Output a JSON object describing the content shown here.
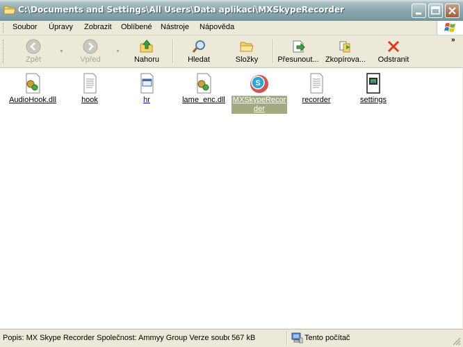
{
  "window": {
    "title": "C:\\Documents and Settings\\All Users\\Data aplikací\\MXSkypeRecorder"
  },
  "menu": [
    {
      "label": "Soubor"
    },
    {
      "label": "Úpravy"
    },
    {
      "label": "Zobrazit"
    },
    {
      "label": "Oblíbené"
    },
    {
      "label": "Nástroje"
    },
    {
      "label": "Nápověda"
    }
  ],
  "toolbar": {
    "back": "Zpět",
    "forward": "Vpřed",
    "up": "Nahoru",
    "search": "Hledat",
    "folders": "Složky",
    "move": "Přesunout...",
    "copy": "Zkopírova...",
    "delete": "Odstranit"
  },
  "files": [
    {
      "name": "AudioHook.dll",
      "icon": "dll-icon"
    },
    {
      "name": "hook",
      "icon": "text-file-icon"
    },
    {
      "name": "hr",
      "icon": "html-file-icon"
    },
    {
      "name": "lame_enc.dll",
      "icon": "dll-icon"
    },
    {
      "name": "MXSkypeRecorder",
      "icon": "skype-recorder-icon",
      "selected": true
    },
    {
      "name": "recorder",
      "icon": "text-file-icon"
    },
    {
      "name": "settings",
      "icon": "image-file-icon"
    }
  ],
  "status": {
    "description": "Popis: MX Skype Recorder Společnost: Ammyy Group Verze soubor",
    "size": "567 kB",
    "location": "Tento počítač"
  },
  "colors": {
    "titlebar": "#7f9da4",
    "selection": "#a2aa80",
    "content_bg": "#ffffff",
    "chrome_bg": "#ece9d8"
  }
}
